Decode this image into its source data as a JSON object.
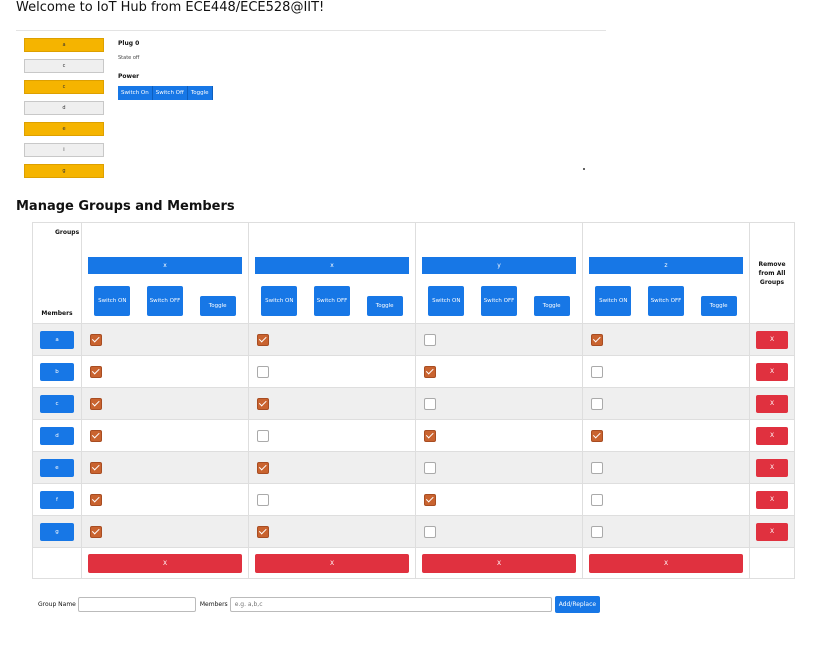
{
  "page": {
    "title": "Welcome to IoT Hub from ECE448/ECE528@IIT!",
    "subtitle": "Manage Groups and Members"
  },
  "devices": [
    {
      "name": "a",
      "state": "on"
    },
    {
      "name": "c",
      "state": "off"
    },
    {
      "name": "c",
      "state": "on"
    },
    {
      "name": "d",
      "state": "off"
    },
    {
      "name": "e",
      "state": "on"
    },
    {
      "name": "i",
      "state": "off"
    },
    {
      "name": "g",
      "state": "on"
    }
  ],
  "panel": {
    "device_label": "Plug 0",
    "state_text": "State off",
    "power_label": "Power",
    "buttons": [
      "Switch On",
      "Switch Off",
      "Toggle"
    ]
  },
  "table": {
    "groups_label": "Groups",
    "members_label": "Members",
    "remove_all_label": "Remove from All Groups",
    "group_buttons": {
      "on": "Switch ON",
      "off": "Switch OFF",
      "toggle": "Toggle"
    },
    "groups": [
      "x",
      "x",
      "y",
      "z"
    ],
    "members": [
      "a",
      "b",
      "c",
      "d",
      "e",
      "f",
      "g"
    ],
    "remove_label": "X",
    "membership": [
      [
        true,
        true,
        false,
        true
      ],
      [
        true,
        false,
        true,
        false
      ],
      [
        true,
        true,
        false,
        false
      ],
      [
        true,
        false,
        true,
        true
      ],
      [
        true,
        true,
        false,
        false
      ],
      [
        true,
        false,
        true,
        false
      ],
      [
        true,
        true,
        false,
        false
      ]
    ]
  },
  "footer": {
    "group_name_label": "Group Name",
    "group_name_value": "",
    "members_label": "Members",
    "members_placeholder": "e.g. a,b,c",
    "add_button": "Add/Replace"
  },
  "colors": {
    "primary": "#1777e6",
    "danger": "#e0313f",
    "plug_on": "#f5b400",
    "checkbox_on": "#c9632f"
  }
}
